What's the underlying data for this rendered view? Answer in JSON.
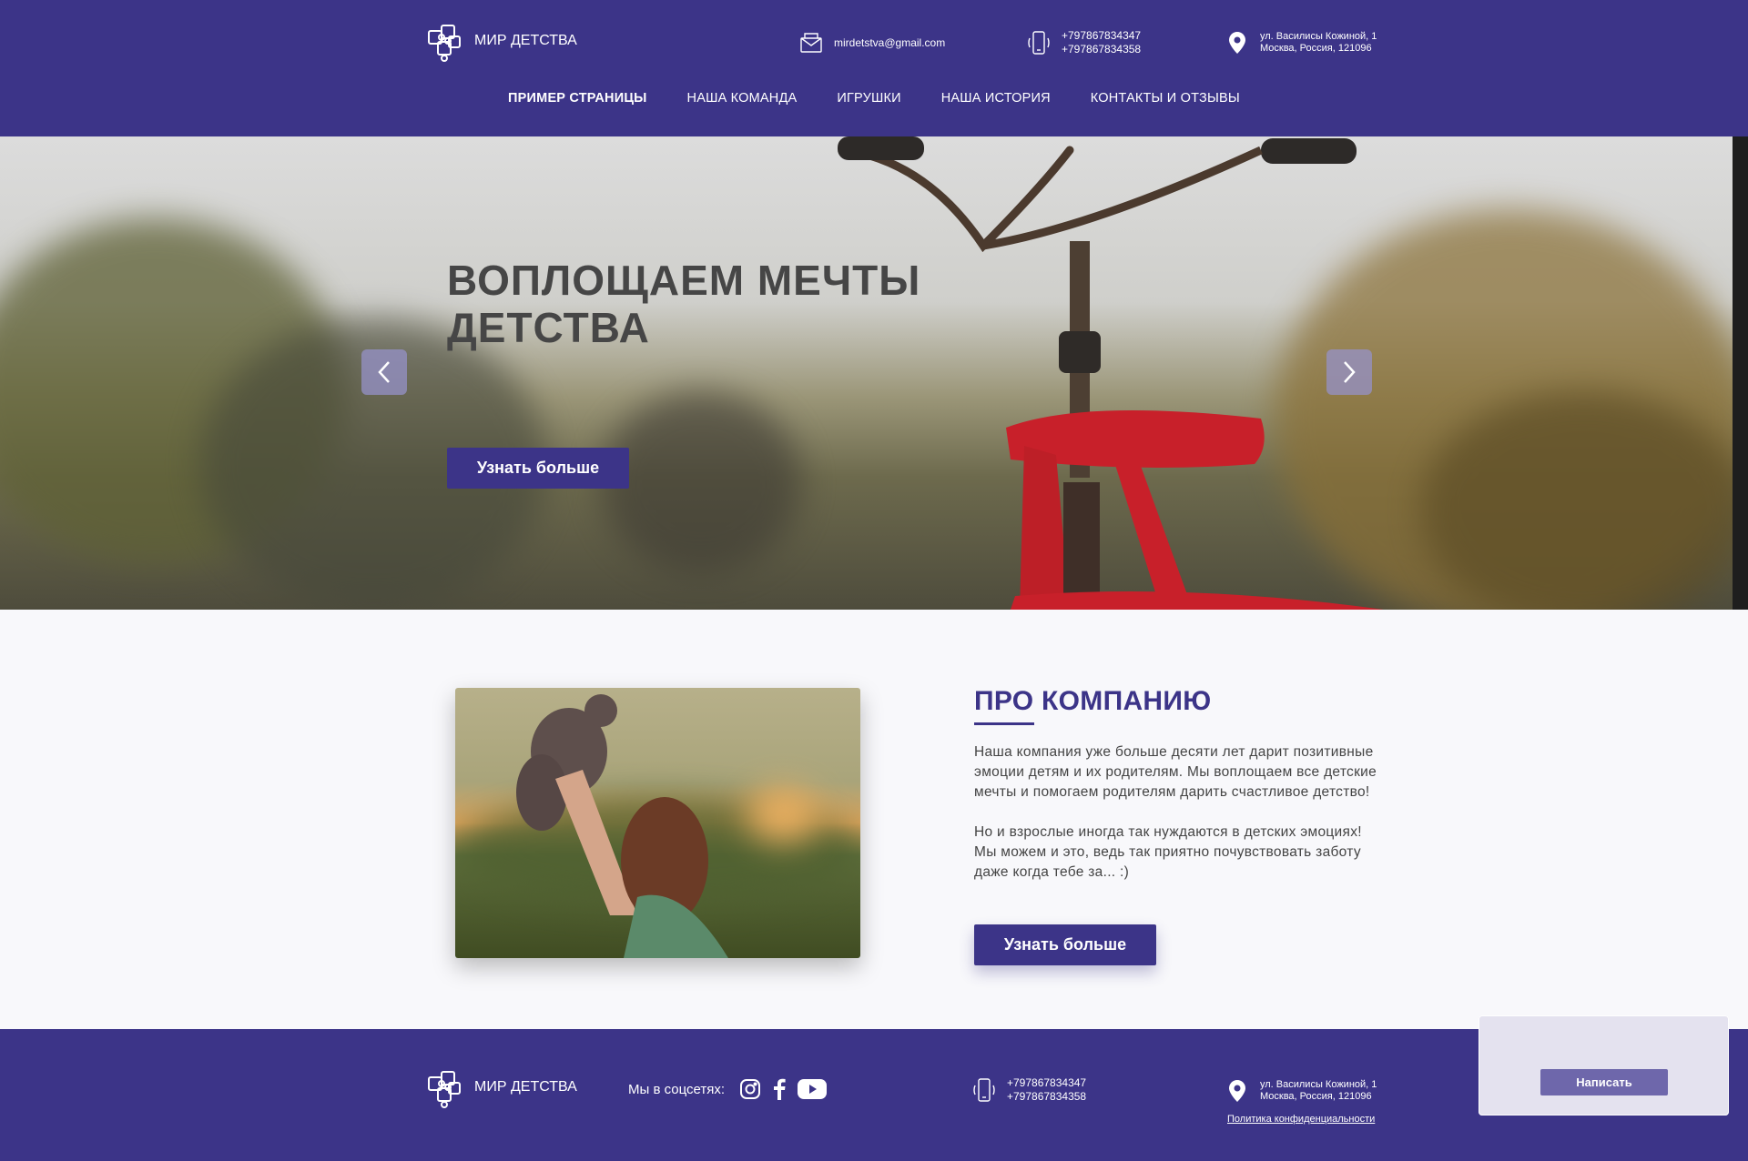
{
  "header": {
    "logo_text": "МИР ДЕТСТВА",
    "email": "mirdetstva@gmail.com",
    "phone1": "+797867834347",
    "phone2": "+797867834358",
    "address1": "ул. Василисы Кожиной, 1",
    "address2": "Москва, Россия, 121096"
  },
  "nav": [
    {
      "label": "ПРИМЕР СТРАНИЦЫ",
      "active": true
    },
    {
      "label": "НАША КОМАНДА"
    },
    {
      "label": "ИГРУШКИ"
    },
    {
      "label": "НАША ИСТОРИЯ"
    },
    {
      "label": "КОНТАКТЫ И ОТЗЫВЫ"
    }
  ],
  "hero": {
    "title_line1": "ВОПЛОЩАЕМ МЕЧТЫ",
    "title_line2": "ДЕТСТВА",
    "button": "Узнать больше"
  },
  "about": {
    "title": "ПРО КОМПАНИЮ",
    "paragraph1": "Наша компания уже больше десяти лет дарит позитивные эмоции детям и их родителям. Мы воплощаем все детские мечты и помогаем родителям дарить счастливое детство!",
    "paragraph2": "Но и взрослые иногда так нуждаются в детских эмоциях! Мы можем и это, ведь так приятно почувствовать заботу даже когда тебе за... :)",
    "button": "Узнать больше"
  },
  "footer": {
    "logo_text": "МИР ДЕТСТВА",
    "social_label": "Мы в соцсетях:",
    "phone1": "+797867834347",
    "phone2": "+797867834358",
    "address1": "ул. Василисы Кожиной, 1",
    "address2": "Москва, Россия, 121096",
    "privacy": "Политика конфиденциальности"
  },
  "widget": {
    "button": "Написать"
  },
  "colors": {
    "brand": "#3c3488",
    "hero_text": "#464646",
    "bike_red": "#c8202a"
  }
}
